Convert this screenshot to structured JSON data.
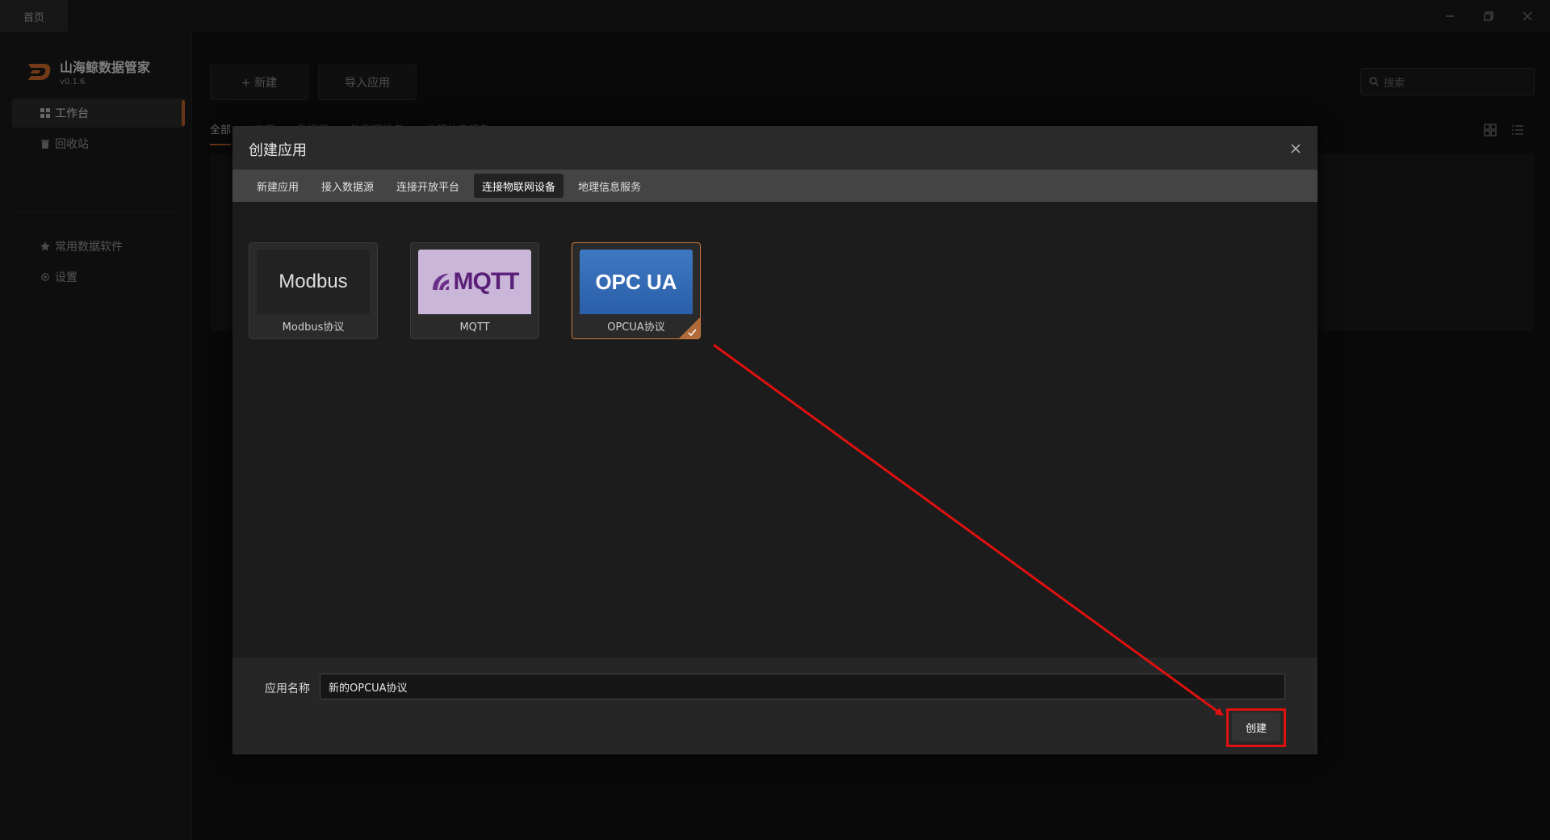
{
  "titlebar": {
    "home_tab": "首页"
  },
  "sidebar": {
    "app_title": "山海鲸数据管家",
    "version": "v0.1.6",
    "items": [
      {
        "label": "工作台",
        "icon": "grid-icon",
        "active": true
      },
      {
        "label": "回收站",
        "icon": "trash-icon",
        "active": false
      },
      {
        "label": "常用数据软件",
        "icon": "star-icon",
        "active": false
      },
      {
        "label": "设置",
        "icon": "gear-icon",
        "active": false
      }
    ]
  },
  "main": {
    "new_button": "+ 新建",
    "import_button": "导入应用",
    "search_placeholder": "搜索",
    "filters": [
      "全部",
      "应用",
      "数据源",
      "物联网设备",
      "地理信息服务"
    ]
  },
  "dialog": {
    "title": "创建应用",
    "tabs": [
      {
        "label": "新建应用",
        "active": false
      },
      {
        "label": "接入数据源",
        "active": false
      },
      {
        "label": "连接开放平台",
        "active": false
      },
      {
        "label": "连接物联网设备",
        "active": true
      },
      {
        "label": "地理信息服务",
        "active": false
      }
    ],
    "cards": [
      {
        "logo_text": "Modbus",
        "label": "Modbus协议",
        "selected": false
      },
      {
        "logo_text": "MQTT",
        "label": "MQTT",
        "selected": false
      },
      {
        "logo_text": "OPC UA",
        "label": "OPCUA协议",
        "selected": true
      }
    ],
    "name_label": "应用名称",
    "name_value": "新的OPCUA协议",
    "create_button": "创建"
  },
  "colors": {
    "accent": "#c0622a",
    "annotation": "#e01010"
  }
}
